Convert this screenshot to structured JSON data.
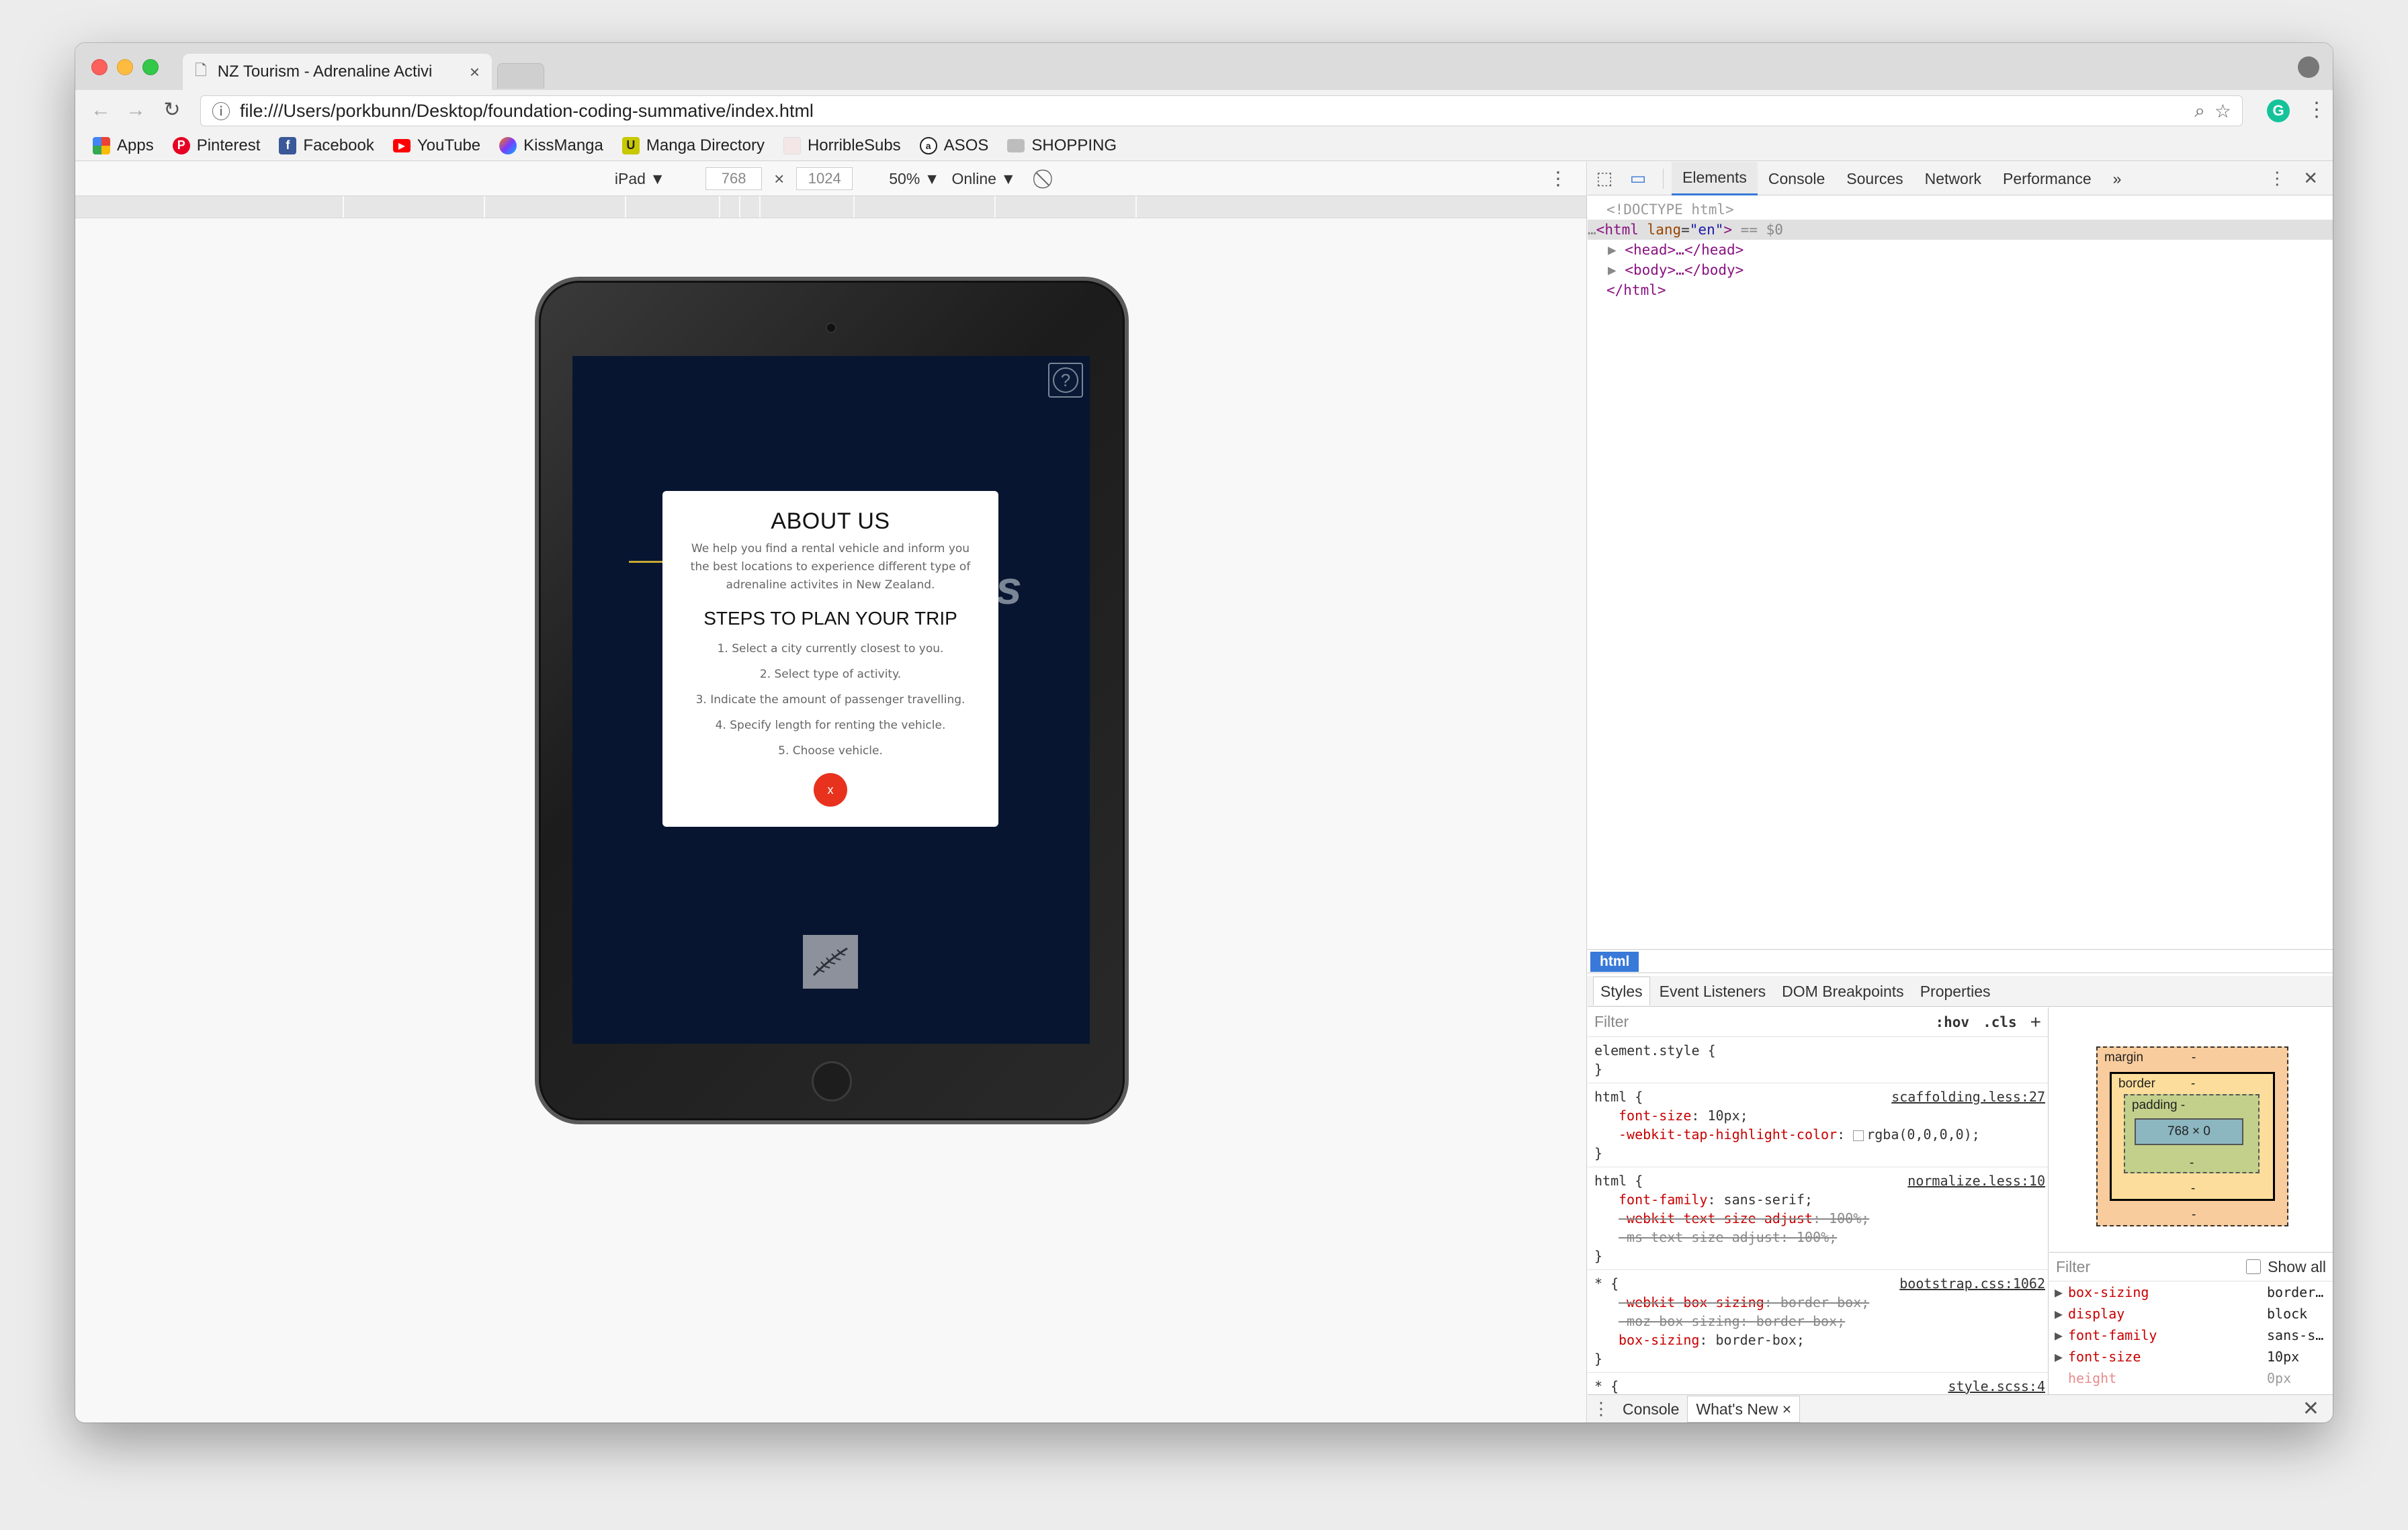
{
  "browser": {
    "tab_title": "NZ Tourism - Adrenaline Activi",
    "url": "file:///Users/porkbunn/Desktop/foundation-coding-summative/index.html",
    "bookmarks": [
      "Apps",
      "Pinterest",
      "Facebook",
      "YouTube",
      "KissManga",
      "Manga Directory",
      "HorribleSubs",
      "ASOS",
      "SHOPPING"
    ]
  },
  "device_toolbar": {
    "device": "iPad",
    "width": "768",
    "height": "1024",
    "zoom": "50%",
    "network": "Online"
  },
  "page": {
    "modal": {
      "title": "ABOUT US",
      "description": "We help you find a rental vehicle and inform you the best locations to experience different type of adrenaline activites in New Zealand.",
      "steps_title": "STEPS TO PLAN YOUR TRIP",
      "steps": [
        "1. Select a city currently closest to you.",
        "2. Select type of activity.",
        "3. Indicate the amount of passenger travelling.",
        "4. Specify length for renting the vehicle.",
        "5. Choose vehicle."
      ],
      "close_label": "x"
    },
    "help_label": "?",
    "bg_letter": "s"
  },
  "devtools": {
    "tabs": [
      "Elements",
      "Console",
      "Sources",
      "Network",
      "Performance"
    ],
    "more_tabs": "»",
    "dom": {
      "doctype": "<!DOCTYPE html>",
      "html_prefix": "…",
      "html_open": "<html lang=\"en\">",
      "html_tag": "html",
      "html_attr": "lang",
      "html_attr_val": "\"en\"",
      "html_suffix": "== $0",
      "head": "<head>…</head>",
      "body": "<body>…</body>",
      "html_close": "</html>"
    },
    "breadcrumb": "html",
    "subtabs": [
      "Styles",
      "Event Listeners",
      "DOM Breakpoints",
      "Properties"
    ],
    "styles": {
      "filter_placeholder": "Filter",
      "hov": ":hov",
      "cls": ".cls",
      "add": "+",
      "rules": [
        {
          "selector": "element.style {",
          "source": "",
          "decls": [],
          "close": "}"
        },
        {
          "selector": "html {",
          "source": "scaffolding.less:27",
          "decls": [
            {
              "name": "font-size",
              "value": "10px;",
              "struck": false
            },
            {
              "name": "-webkit-tap-highlight-color",
              "value": "rgba(0,0,0,0);",
              "struck": false,
              "swatch": true
            }
          ],
          "close": "}"
        },
        {
          "selector": "html {",
          "source": "normalize.less:10",
          "decls": [
            {
              "name": "font-family",
              "value": "sans-serif;",
              "struck": false
            },
            {
              "name": "-webkit-text-size-adjust",
              "value": "100%;",
              "struck": true
            },
            {
              "name": "-ms-text-size-adjust",
              "value": "100%;",
              "struck": true
            }
          ],
          "close": "}"
        },
        {
          "selector": "* {",
          "source": "bootstrap.css:1062",
          "decls": [
            {
              "name": "-webkit-box-sizing",
              "value": "border-box;",
              "struck": true
            },
            {
              "name": "-moz-box-sizing",
              "value": "border-box;",
              "struck": true
            },
            {
              "name": "box-sizing",
              "value": "border-box;",
              "struck": false
            }
          ],
          "close": "}"
        },
        {
          "selector": "* {",
          "source": "style.scss:4",
          "decls": [],
          "close": ""
        }
      ]
    },
    "box_model": {
      "margin_label": "margin",
      "border_label": "border",
      "padding_label": "padding -",
      "content": "768 × 0",
      "dash": "-"
    },
    "computed": {
      "filter_placeholder": "Filter",
      "show_all": "Show all",
      "rows": [
        {
          "name": "box-sizing",
          "value": "border…"
        },
        {
          "name": "display",
          "value": "block"
        },
        {
          "name": "font-family",
          "value": "sans-s…"
        },
        {
          "name": "font-size",
          "value": "10px"
        },
        {
          "name": "height",
          "value": "0px"
        }
      ]
    },
    "drawer_tabs": [
      "Console",
      "What's New"
    ]
  },
  "colors": {
    "screen_bg": "#071530",
    "close_button": "#e8321e",
    "devtools_accent": "#3879d9"
  }
}
